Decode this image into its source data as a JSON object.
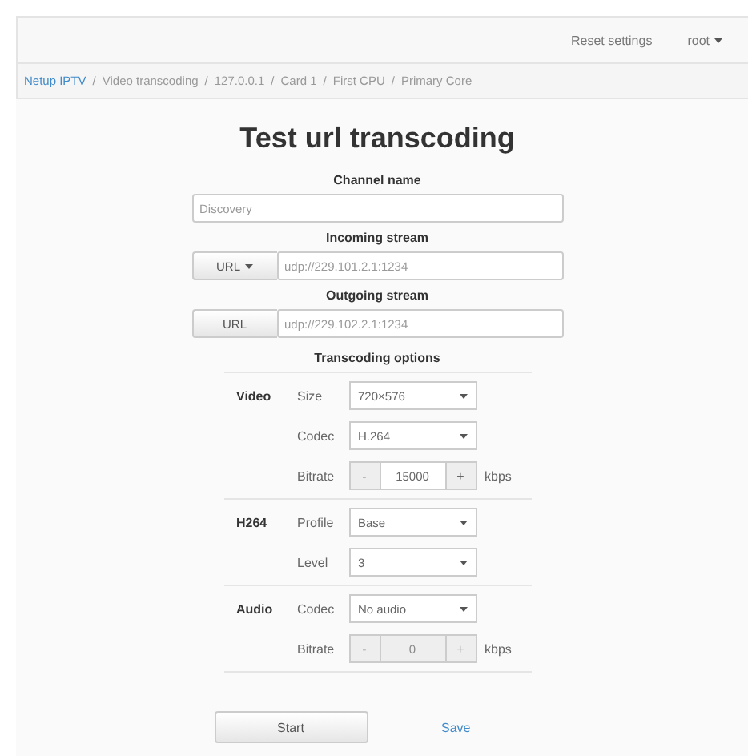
{
  "navbar": {
    "links": [
      "Reset settings"
    ],
    "user_menu": "root"
  },
  "breadcrumb_separator": "/",
  "breadcrumb": [
    {
      "label": "Netup IPTV",
      "kind": "link"
    },
    {
      "label": "Video transcoding",
      "kind": "text"
    },
    {
      "label": "127.0.0.1",
      "kind": "text"
    },
    {
      "label": "Card 1",
      "kind": "text"
    },
    {
      "label": "First CPU",
      "kind": "text"
    },
    {
      "label": "Primary Core",
      "kind": "text"
    }
  ],
  "title": "Test url transcoding",
  "channel": {
    "label": "Channel name",
    "placeholder": "Discovery"
  },
  "streams": [
    {
      "label": "Incoming stream",
      "button": "URL",
      "dropdown": true,
      "placeholder": "udp://229.101.2.1:1234"
    },
    {
      "label": "Outgoing stream",
      "button": "URL",
      "dropdown": false,
      "placeholder": "udp://229.102.2.1:1234"
    }
  ],
  "options_title": "Transcoding options",
  "sections": [
    {
      "name": "Video",
      "rows": [
        {
          "label": "Size",
          "kind": "select",
          "value": "720×576"
        },
        {
          "label": "Codec",
          "kind": "select",
          "value": "H.264"
        },
        {
          "label": "Bitrate",
          "kind": "stepper",
          "minus": "-",
          "value": "15000",
          "plus": "+",
          "unit": "kbps",
          "disabled": false
        }
      ]
    },
    {
      "name": "H264",
      "rows": [
        {
          "label": "Profile",
          "kind": "select",
          "value": "Base"
        },
        {
          "label": "Level",
          "kind": "select",
          "value": "3"
        }
      ]
    },
    {
      "name": "Audio",
      "rows": [
        {
          "label": "Codec",
          "kind": "select",
          "value": "No audio"
        },
        {
          "label": "Bitrate",
          "kind": "stepper",
          "minus": "-",
          "value": "0",
          "plus": "+",
          "unit": "kbps",
          "disabled": true
        }
      ]
    }
  ],
  "actions": {
    "start": "Start",
    "save": "Save"
  }
}
